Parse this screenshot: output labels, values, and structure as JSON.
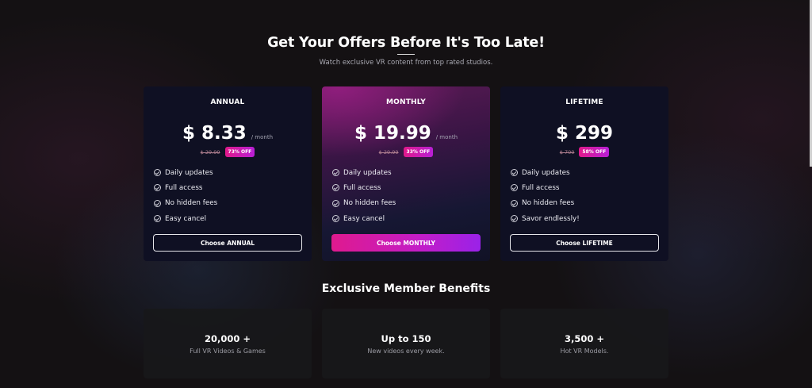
{
  "hero": {
    "title": "Get Your Offers Before It's Too Late!",
    "subtitle": "Watch exclusive VR content from top rated studios."
  },
  "plans": [
    {
      "name": "ANNUAL",
      "price": "$ 8.33",
      "per": "/ month",
      "old_price": "$ 29.99",
      "badge": "73% OFF",
      "features": [
        "Daily updates",
        "Full access",
        "No hidden fees",
        "Easy cancel"
      ],
      "cta": "Choose ANNUAL"
    },
    {
      "name": "MONTHLY",
      "price": "$ 19.99",
      "per": "/ month",
      "old_price": "$ 29.99",
      "badge": "33% OFF",
      "features": [
        "Daily updates",
        "Full access",
        "No hidden fees",
        "Easy cancel"
      ],
      "cta": "Choose MONTHLY"
    },
    {
      "name": "LIFETIME",
      "price": "$ 299",
      "old_price": "$ 700",
      "badge": "58% OFF",
      "features": [
        "Daily updates",
        "Full access",
        "No hidden fees",
        "Savor endlessly!"
      ],
      "cta": "Choose LIFETIME"
    }
  ],
  "benefits": {
    "title": "Exclusive Member Benefits",
    "items": [
      {
        "value": "20,000 +",
        "label": "Full VR Videos & Games"
      },
      {
        "value": "Up to 150",
        "label": "New videos every week."
      },
      {
        "value": "3,500 +",
        "label": "Hot VR Models."
      }
    ]
  },
  "colors": {
    "background": "#141113",
    "card": "#0f1023",
    "accent_start": "#df1a8e",
    "accent_end": "#9a22e8"
  }
}
